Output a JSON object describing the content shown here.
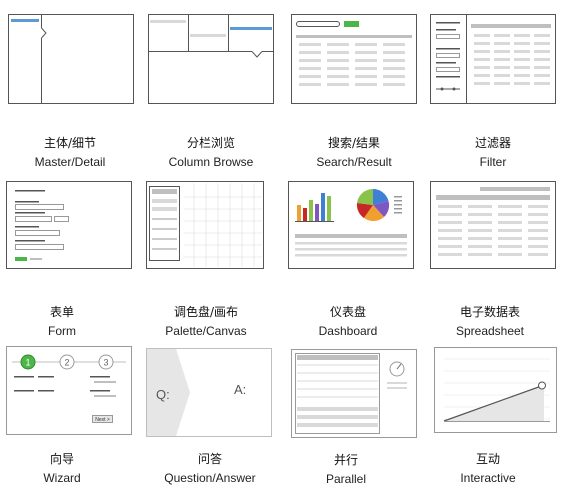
{
  "patterns": [
    {
      "zh": "主体/细节",
      "en": "Master/Detail",
      "icon": "master-detail-icon"
    },
    {
      "zh": "分栏浏览",
      "en": "Column Browse",
      "icon": "column-browse-icon"
    },
    {
      "zh": "搜索/结果",
      "en": "Search/Result",
      "icon": "search-result-icon"
    },
    {
      "zh": "过滤器",
      "en": "Filter",
      "icon": "filter-icon"
    },
    {
      "zh": "表单",
      "en": "Form",
      "icon": "form-icon"
    },
    {
      "zh": "调色盘/画布",
      "en": "Palette/Canvas",
      "icon": "palette-canvas-icon"
    },
    {
      "zh": "仪表盘",
      "en": "Dashboard",
      "icon": "dashboard-icon"
    },
    {
      "zh": "电子数据表",
      "en": "Spreadsheet",
      "icon": "spreadsheet-icon"
    },
    {
      "zh": "向导",
      "en": "Wizard",
      "icon": "wizard-icon"
    },
    {
      "zh": "问答",
      "en": "Question/Answer",
      "icon": "question-answer-icon"
    },
    {
      "zh": "并行",
      "en": "Parallel",
      "icon": "parallel-icon"
    },
    {
      "zh": "互动",
      "en": "Interactive",
      "icon": "interactive-icon"
    }
  ],
  "thumb_text": {
    "wizard_steps": [
      "1",
      "2",
      "3"
    ],
    "wizard_next": "Next >",
    "question": "Q:",
    "answer": "A:"
  },
  "colors": {
    "accent_blue": "#5b9bd5",
    "accent_green": "#4cb648",
    "frame": "#555555",
    "bar": "#d9d9d9"
  }
}
